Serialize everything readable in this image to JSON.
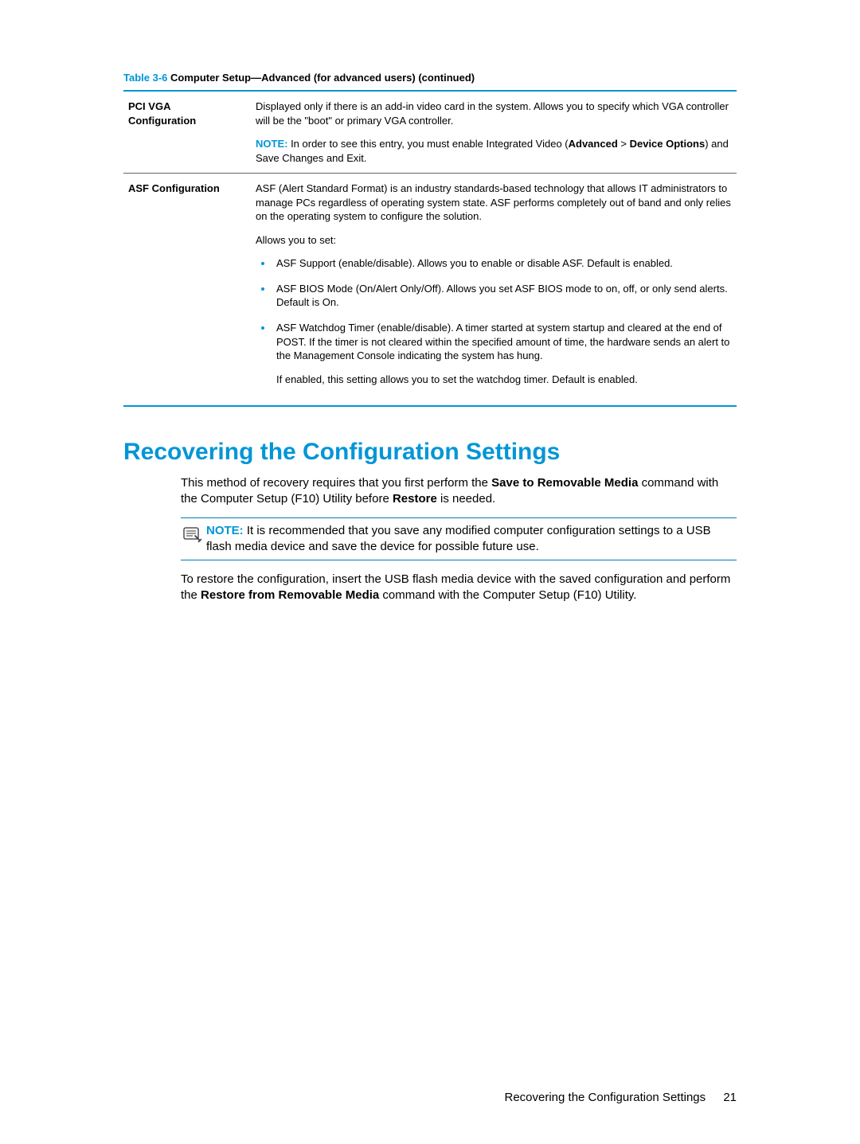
{
  "table": {
    "caption_label": "Table 3-6",
    "caption_title": " Computer Setup—Advanced (for advanced users) (continued)",
    "rows": [
      {
        "left_line1": "PCI VGA",
        "left_line2": "Configuration",
        "desc1": "Displayed only if there is an add-in video card in the system. Allows you to specify which VGA controller will be the \"boot\" or primary VGA controller.",
        "note_label": "NOTE:",
        "note_after": " In order to see this entry, you must enable Integrated Video (",
        "note_bold1": "Advanced",
        "note_gt": " > ",
        "note_bold2": "Device Options",
        "note_end": ") and Save Changes and Exit."
      },
      {
        "left_line1": "ASF Configuration",
        "desc1": "ASF (Alert Standard Format) is an industry standards-based technology that allows IT administrators to manage PCs regardless of operating system state. ASF performs completely out of band and only relies on the operating system to configure the solution.",
        "desc2": "Allows you to set:",
        "bullets": [
          {
            "text": "ASF Support (enable/disable). Allows you to enable or disable ASF. Default is enabled."
          },
          {
            "text": "ASF BIOS Mode (On/Alert Only/Off). Allows you set ASF BIOS mode to on, off, or only send alerts. Default is On."
          },
          {
            "text": "ASF Watchdog Timer (enable/disable). A timer started at system startup and cleared at the end of POST. If the timer is not cleared within the specified amount of time, the hardware sends an alert to the Management Console indicating the system has hung.",
            "text2": "If enabled, this setting allows you to set the watchdog timer. Default is enabled."
          }
        ]
      }
    ]
  },
  "heading": "Recovering the Configuration Settings",
  "para1_pre": "This method of recovery requires that you first perform the ",
  "para1_bold1": "Save to Removable Media",
  "para1_mid": " command with the Computer Setup (F10) Utility before ",
  "para1_bold2": "Restore",
  "para1_end": " is needed.",
  "noteblock": {
    "label": "NOTE:",
    "text": " It is recommended that you save any modified computer configuration settings to a USB flash media device and save the device for possible future use."
  },
  "para2_pre": "To restore the configuration, insert the USB flash media device with the saved configuration and perform the ",
  "para2_bold": "Restore from Removable Media",
  "para2_end": " command with the Computer Setup (F10) Utility.",
  "footer": {
    "text": "Recovering the Configuration Settings",
    "page": "21"
  }
}
